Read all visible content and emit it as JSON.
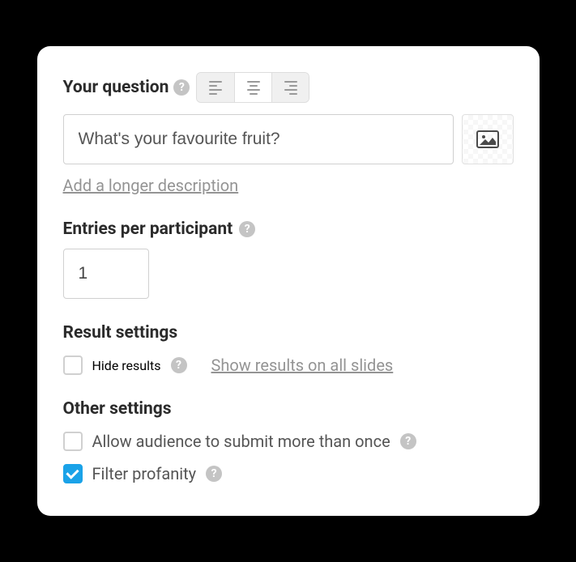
{
  "question": {
    "label": "Your question",
    "value": "What's your favourite fruit?",
    "desc_link": "Add a longer description"
  },
  "entries": {
    "label": "Entries per participant",
    "value": "1"
  },
  "result": {
    "heading": "Result settings",
    "hide_label": "Hide results",
    "show_all_label": "Show results on all slides"
  },
  "other": {
    "heading": "Other settings",
    "allow_resubmit_label": "Allow audience to submit more than once",
    "filter_profanity_label": "Filter profanity"
  }
}
